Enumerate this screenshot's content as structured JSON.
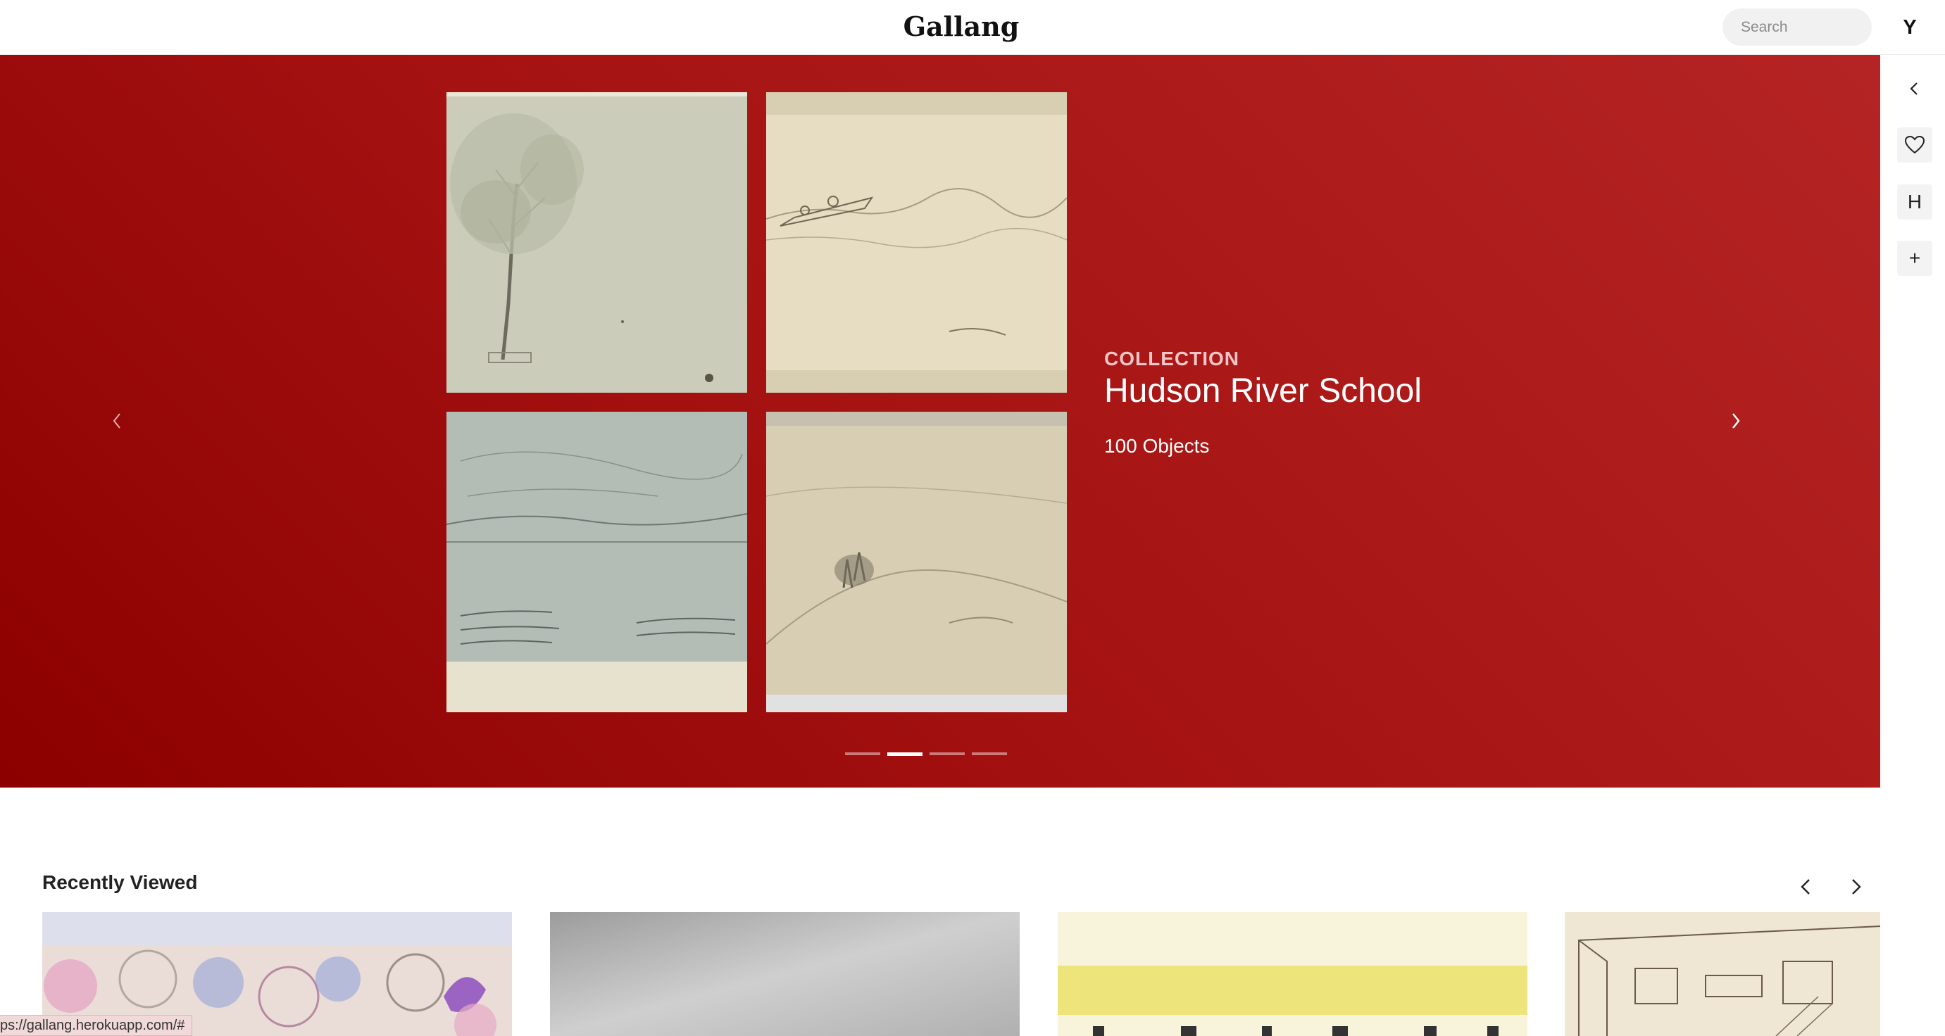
{
  "header": {
    "logo": "Gallang",
    "search_placeholder": "Search",
    "avatar_initial": "Y"
  },
  "hero": {
    "eyebrow": "COLLECTION",
    "title": "Hudson River School",
    "count": "100 Objects",
    "slides_total": 4,
    "active_slide": 2,
    "background_colors": [
      "#8c0000",
      "#b52424"
    ]
  },
  "rail": {
    "collapse_icon": "chevron-left-icon",
    "favorite_icon": "heart-icon",
    "h_label": "H",
    "add_label": "+"
  },
  "recently_viewed": {
    "title": "Recently Viewed"
  },
  "status_bar": {
    "url": "ps://gallang.herokuapp.com/#"
  }
}
